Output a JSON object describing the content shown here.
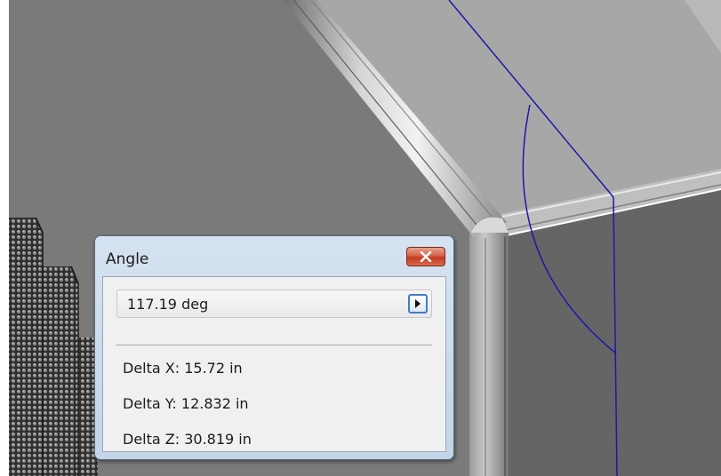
{
  "dialog": {
    "title": "Angle",
    "angle_value": "117.19 deg",
    "measurements": [
      {
        "label": "Delta X:",
        "value": "15.72 in"
      },
      {
        "label": "Delta Y:",
        "value": "12.832 in"
      },
      {
        "label": "Delta Z:",
        "value": "30.819 in"
      }
    ]
  },
  "icons": {
    "close": "close-x-icon",
    "arrow": "play-right-icon"
  },
  "colors": {
    "title_bar": "#c9d8ec",
    "close_button": "#c94a31",
    "measure_line": "#1a1aa8",
    "panel_gray": "#707070"
  }
}
